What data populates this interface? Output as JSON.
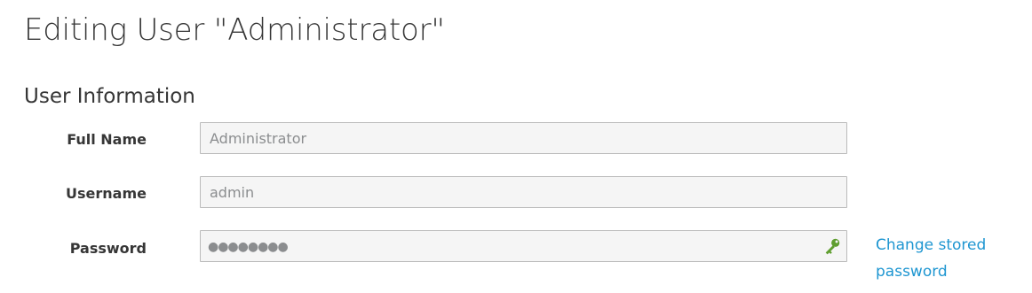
{
  "page": {
    "title": "Editing User \"Administrator\""
  },
  "section": {
    "title": "User Information"
  },
  "form": {
    "full_name": {
      "label": "Full Name",
      "value": "Administrator"
    },
    "username": {
      "label": "Username",
      "value": "admin"
    },
    "password": {
      "label": "Password",
      "masked_value": "●●●●●●●●",
      "icon": "key-icon",
      "icon_color": "#5f9e2f"
    },
    "change_password_link": "Change stored password"
  },
  "colors": {
    "link": "#1e96d1",
    "field_background": "#f5f5f5",
    "field_border": "#bbbbbb"
  }
}
